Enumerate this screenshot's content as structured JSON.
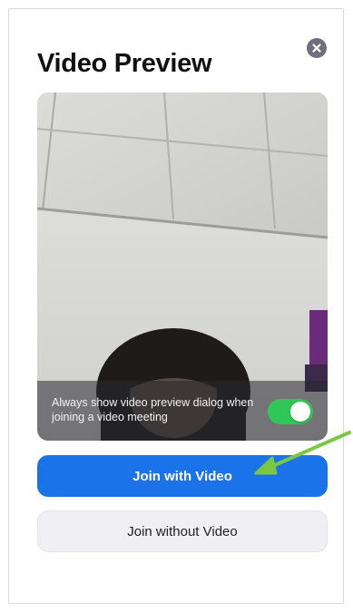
{
  "dialog": {
    "title": "Video Preview",
    "close_icon": "close-icon"
  },
  "preview": {
    "always_show_text": "Always show video preview dialog when joining a video meeting",
    "always_show_enabled": true
  },
  "buttons": {
    "join_with_video": "Join with Video",
    "join_without_video": "Join without Video"
  },
  "colors": {
    "primary": "#1a73e8",
    "toggle_on": "#30c759",
    "arrow": "#7cc843",
    "close": "#6f6f7d"
  }
}
